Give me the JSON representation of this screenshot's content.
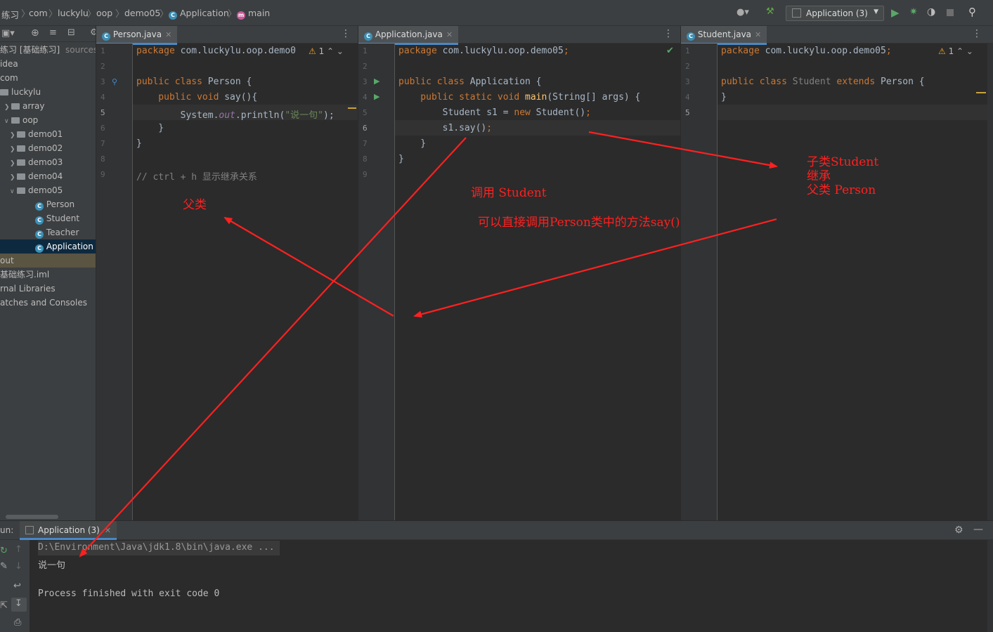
{
  "breadcrumb": {
    "items": [
      "练习",
      "com",
      "luckylu",
      "oop",
      "demo05",
      "Application",
      "main"
    ]
  },
  "toolbar": {
    "run_config": "Application (3)"
  },
  "sidebar": {
    "project_root": "练习 [基础练习]",
    "root_suffix": "sources",
    "items": [
      {
        "label": "idea",
        "type": "folder"
      },
      {
        "label": "com",
        "type": "folder"
      },
      {
        "label": "luckylu",
        "type": "folder"
      },
      {
        "label": "array",
        "type": "folder"
      },
      {
        "label": "oop",
        "type": "folder"
      },
      {
        "label": "demo01",
        "type": "folder"
      },
      {
        "label": "demo02",
        "type": "folder"
      },
      {
        "label": "demo03",
        "type": "folder"
      },
      {
        "label": "demo04",
        "type": "folder"
      },
      {
        "label": "demo05",
        "type": "folder"
      },
      {
        "label": "Person",
        "type": "class"
      },
      {
        "label": "Student",
        "type": "class"
      },
      {
        "label": "Teacher",
        "type": "class"
      },
      {
        "label": "Application",
        "type": "class"
      },
      {
        "label": "out",
        "type": "folder"
      },
      {
        "label": "基础练习.iml",
        "type": "file"
      },
      {
        "label": "rnal Libraries",
        "type": "lib"
      },
      {
        "label": "atches and Consoles",
        "type": "scratch"
      }
    ]
  },
  "editors": [
    {
      "tab": "Person.java",
      "warnings": "1",
      "lines": [
        "1",
        "2",
        "3",
        "4",
        "5",
        "6",
        "7",
        "8",
        "9"
      ]
    },
    {
      "tab": "Application.java",
      "lines": [
        "1",
        "2",
        "3",
        "4",
        "5",
        "6",
        "7",
        "8",
        "9"
      ]
    },
    {
      "tab": "Student.java",
      "warnings": "1",
      "lines": [
        "1",
        "2",
        "3",
        "4",
        "5"
      ]
    }
  ],
  "code": {
    "person": {
      "l1a": "package",
      "l1b": " com.luckylu.oop.demo0",
      "l3a": "public class",
      "l3b": " Person {",
      "l4a": "    public void",
      "l4b": " say",
      "l4c": "(){",
      "l5a": "        System.",
      "l5b": "out",
      "l5c": ".println(",
      "l5d": "\"说一句\"",
      "l5e": ");",
      "l6": "    }",
      "l7": "}",
      "l9": "// ctrl + h 显示继承关系"
    },
    "app": {
      "l1a": "package",
      "l1b": " com.luckylu.oop.demo05",
      "l1c": ";",
      "l3a": "public class",
      "l3b": " Application {",
      "l4a": "    public static void",
      "l4b": " main",
      "l4c": "(String[] args) {",
      "l5a": "        Student s1 = ",
      "l5b": "new",
      "l5c": " Student()",
      "l5d": ";",
      "l6a": "        s1.say()",
      "l6b": ";",
      "l7": "    }",
      "l8": "}"
    },
    "student": {
      "l1a": "package",
      "l1b": " com.luckylu.oop.demo05",
      "l1c": ";",
      "l3a": "public class",
      "l3b": " Student ",
      "l3c": "extends",
      "l3d": " Person {",
      "l4": "}"
    }
  },
  "run": {
    "label": "un:",
    "tab": "Application (3)",
    "lines": [
      "D:\\Environment\\Java\\jdk1.8\\bin\\java.exe ...",
      "说一句",
      "",
      "Process finished with exit code 0"
    ]
  },
  "annotations": {
    "parent": "父类",
    "call_student": "调用 Student",
    "call_method": "可以直接调用Person类中的方法say()",
    "inherit_1": "子类Student",
    "inherit_2": "继承",
    "inherit_3": "父类 Person"
  },
  "colors": {
    "annotation": "#ff2020",
    "keyword": "#cc7832",
    "string": "#6a8759",
    "selection": "#0d293e"
  }
}
